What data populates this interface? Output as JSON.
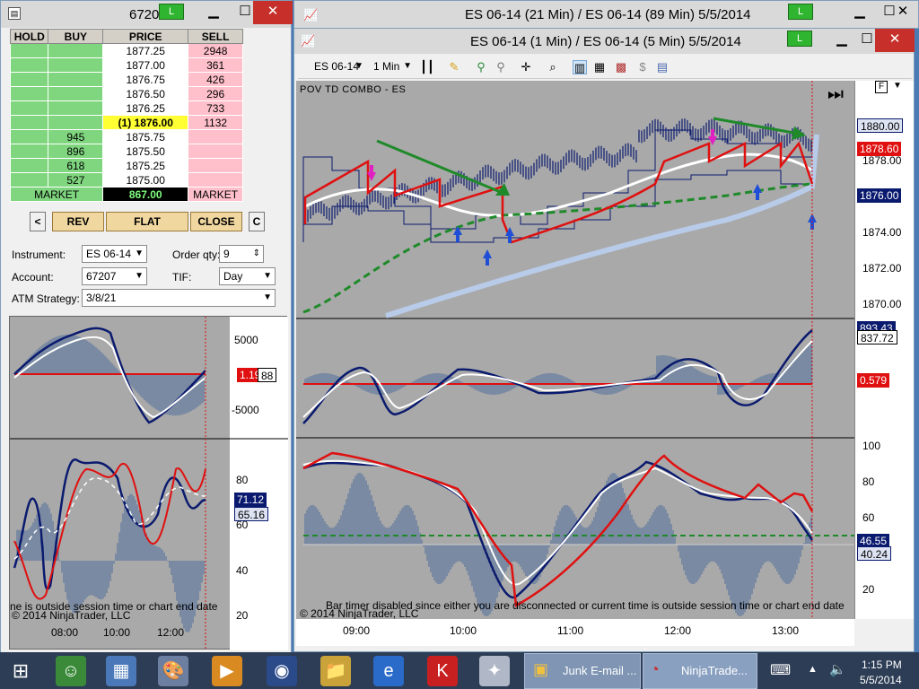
{
  "dom_window": {
    "title": "6720",
    "connection": "L",
    "headers": [
      "HOLD",
      "BUY",
      "PRICE",
      "SELL"
    ],
    "rows": [
      {
        "buy": "",
        "price": "1877.25",
        "sell": "2948"
      },
      {
        "buy": "",
        "price": "1877.00",
        "sell": "361"
      },
      {
        "buy": "",
        "price": "1876.75",
        "sell": "426"
      },
      {
        "buy": "",
        "price": "1876.50",
        "sell": "296"
      },
      {
        "buy": "",
        "price": "1876.25",
        "sell": "733"
      },
      {
        "buy": "",
        "price": "(1) 1876.00",
        "sell": "1132"
      },
      {
        "buy": "945",
        "price": "1875.75",
        "sell": ""
      },
      {
        "buy": "896",
        "price": "1875.50",
        "sell": ""
      },
      {
        "buy": "618",
        "price": "1875.25",
        "sell": ""
      },
      {
        "buy": "527",
        "price": "1875.00",
        "sell": ""
      }
    ],
    "market_left": "MARKET",
    "market_value": "867.00",
    "market_right": "MARKET",
    "btn_left": "<",
    "btn_rev": "REV",
    "btn_flat": "FLAT",
    "btn_close": "CLOSE",
    "btn_c": "C",
    "instrument_label": "Instrument:",
    "instrument_value": "ES 06-14",
    "order_qty_label": "Order qty:",
    "order_qty_value": "9",
    "account_label": "Account:",
    "account_value": "67207",
    "tif_label": "TIF:",
    "tif_value": "Day",
    "atm_label": "ATM Strategy:",
    "atm_value": "3/8/21",
    "mini_ticks_top": [
      "5000",
      "-5000"
    ],
    "mini_tags_top": [
      "1.19",
      "88"
    ],
    "mini_ticks_bottom": [
      "80",
      "60",
      "40",
      "20"
    ],
    "mini_tags_bottom": [
      "71.12",
      "65.16"
    ],
    "mini_footer": "ne is outside session time or chart end date",
    "mini_copyright": "© 2014 NinjaTrader, LLC",
    "mini_xticks": [
      "08:00",
      "10:00",
      "12:00"
    ]
  },
  "back_window": {
    "title": "ES 06-14 (21 Min) / ES 06-14 (89 Min)  5/5/2014",
    "connection": "L"
  },
  "chart_window": {
    "title": "ES 06-14 (1 Min) / ES 06-14 (5 Min)  5/5/2014",
    "connection": "L",
    "toolbar_instrument": "ES 06-14",
    "toolbar_interval": "1 Min",
    "indicator_name": "POV TD COMBO - ES",
    "f_button": "F",
    "price_ticks": [
      "1880.00",
      "1878.00",
      "1876.00",
      "1874.00",
      "1872.00",
      "1870.00"
    ],
    "price_tags": {
      "top": "1880.00",
      "red": "1878.60",
      "navy": "1876.00"
    },
    "mid_tags": {
      "a": "893.43",
      "b": "837.72",
      "red": "0.579"
    },
    "bottom_ticks": [
      "100",
      "80",
      "60",
      "40",
      "20"
    ],
    "bottom_tags": {
      "a": "46.55",
      "b": "40.24"
    },
    "footer": "Bar timer disabled since either you are disconnected or current time is outside session time or chart end date",
    "copyright": "© 2014 NinjaTrader, LLC",
    "xticks": [
      "09:00",
      "10:00",
      "11:00",
      "12:00",
      "13:00"
    ]
  },
  "taskbar": {
    "tasks": [
      "Junk E-mail ...",
      "NinjaTrade..."
    ],
    "time": "1:15 PM",
    "date": "5/5/2014"
  },
  "colors": {
    "buy": "#7fd67f",
    "sell": "#ffc0cb",
    "chart_bg": "#a9a9a9",
    "navy": "#0a1a6e",
    "red_line": "#e01010",
    "trend_arrow": "#1f8a2a",
    "baseline": "#1f8a2a"
  }
}
